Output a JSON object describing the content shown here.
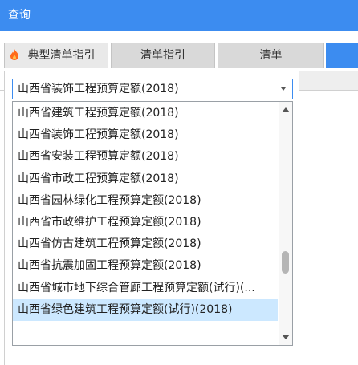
{
  "window": {
    "title": "查询"
  },
  "tabs": [
    {
      "label": "典型清单指引",
      "icon": "flame-icon"
    },
    {
      "label": "清单指引"
    },
    {
      "label": "清单"
    },
    {
      "label": ""
    }
  ],
  "combo": {
    "value": "山西省装饰工程预算定额(2018)"
  },
  "dropdown": {
    "options": [
      "山西省建筑工程预算定额(2018)",
      "山西省装饰工程预算定额(2018)",
      "山西省安装工程预算定额(2018)",
      "山西省市政工程预算定额(2018)",
      "山西省园林绿化工程预算定额(2018)",
      "山西省市政维护工程预算定额(2018)",
      "山西省仿古建筑工程预算定额(2018)",
      "山西省抗震加固工程预算定额(2018)",
      "山西省城市地下综合管廊工程预算定额(试行)(...",
      "山西省绿色建筑工程预算定额(试行)(2018)"
    ],
    "selected_index": 9
  },
  "colors": {
    "titlebar": "#3c8cf0",
    "selection": "#cce8ff",
    "flame": "#ff6a1a"
  }
}
